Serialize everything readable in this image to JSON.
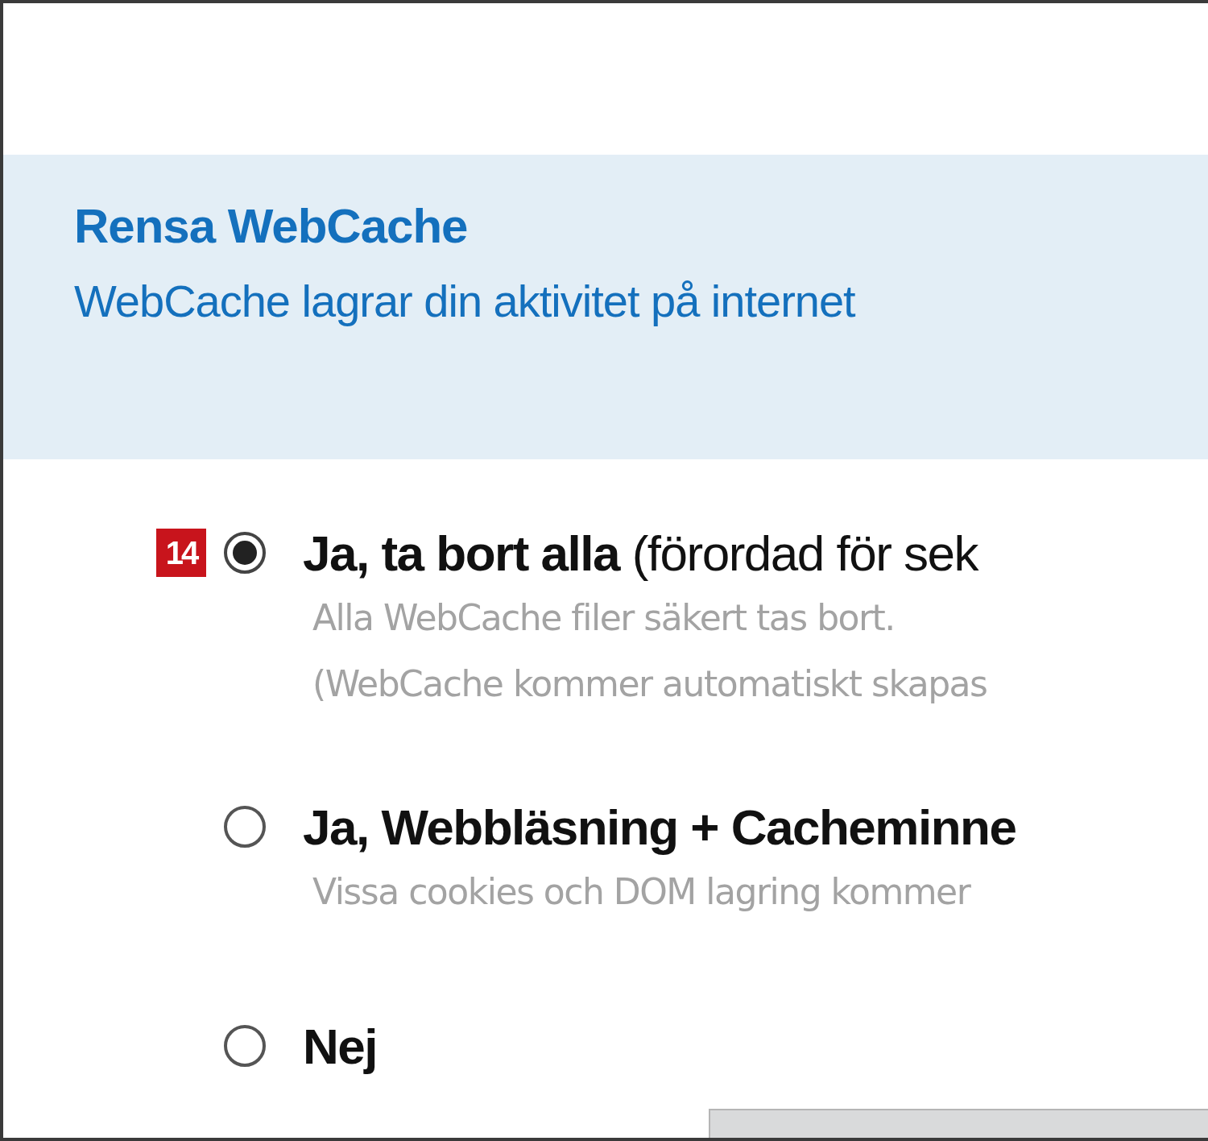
{
  "header": {
    "title": "Rensa WebCache",
    "subtitle": "WebCache lagrar din aktivitet på internet"
  },
  "options": [
    {
      "marker": "14",
      "label": "**Ja, ta bort alla** (förordad för sek",
      "selected": true,
      "descriptions": [
        "Alla WebCache filer säkert tas bort.",
        "(WebCache kommer automatiskt skapas"
      ]
    },
    {
      "label": "**Ja, Webbläsning + Cacheminne**",
      "selected": false,
      "descriptions": [
        "Vissa cookies och DOM lagring kommer"
      ]
    },
    {
      "label": "**Nej**",
      "selected": false
    }
  ]
}
